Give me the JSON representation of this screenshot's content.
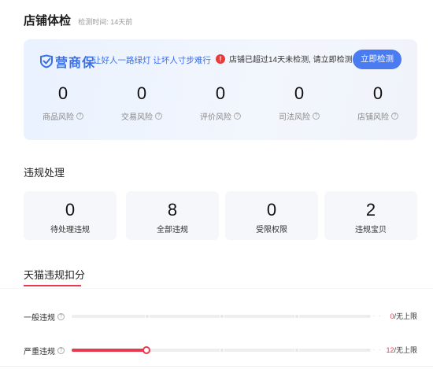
{
  "header": {
    "title": "店铺体检",
    "check_time": "检测时间: 14天前"
  },
  "guard": {
    "logo_text": "营商保",
    "slogan": "让好人一路绿灯 让坏人寸步难行",
    "warning_icon": "!",
    "warning": "店铺已超过14天未检测, 请立即检测",
    "button": "立即检测",
    "accent": "#3a6fe8",
    "risks": [
      {
        "value": "0",
        "label": "商品风险"
      },
      {
        "value": "0",
        "label": "交易风险"
      },
      {
        "value": "0",
        "label": "评价风险"
      },
      {
        "value": "0",
        "label": "司法风险"
      },
      {
        "value": "0",
        "label": "店铺风险"
      }
    ]
  },
  "violations": {
    "title": "违规处理",
    "items": [
      {
        "value": "0",
        "label": "待处理违规"
      },
      {
        "value": "8",
        "label": "全部违规"
      },
      {
        "value": "0",
        "label": "受限权限"
      },
      {
        "value": "2",
        "label": "违规宝贝"
      }
    ]
  },
  "deduction": {
    "tab": "天猫违规扣分",
    "accent": "#e8394f",
    "rows": [
      {
        "label": "一般违规",
        "count": "0",
        "limit": "/无上限",
        "progress": 0
      },
      {
        "label": "严重违规",
        "count": "12",
        "limit": "/无上限",
        "progress": 0.25
      }
    ]
  }
}
